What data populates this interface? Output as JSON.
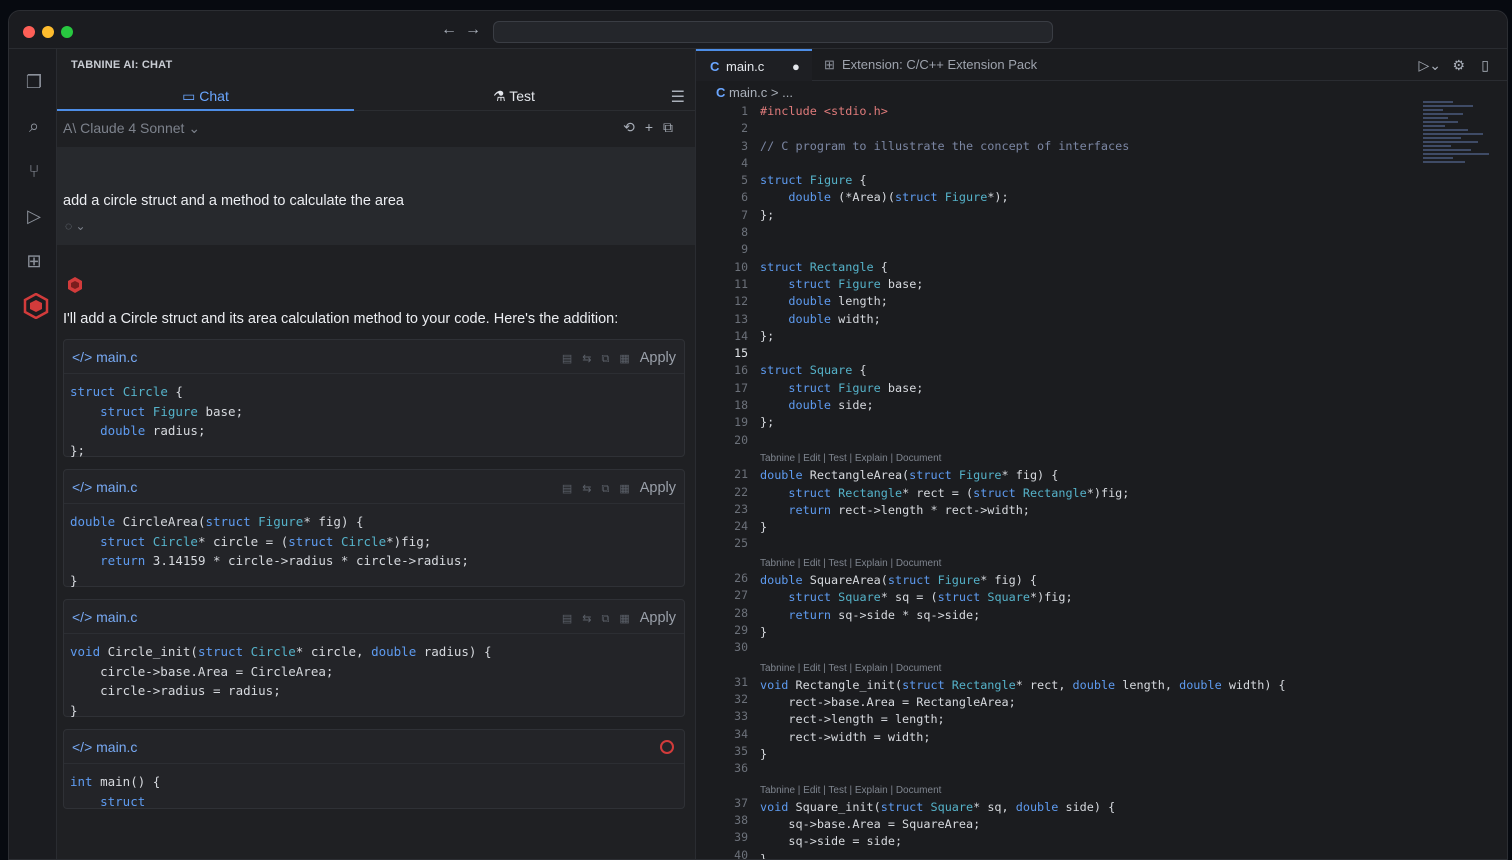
{
  "window": {
    "address_value": ""
  },
  "chat_panel": {
    "title": "TABNINE AI: CHAT",
    "tabs": [
      {
        "label": "Chat",
        "icon": "chat-bubble-icon"
      },
      {
        "label": "Test",
        "icon": "flask-icon"
      }
    ],
    "model": "Claude 4 Sonnet",
    "user_message": "add a circle struct and a method to calculate the area",
    "assistant_intro": "I'll add a Circle struct and its area calculation method to your code. Here's the addition:",
    "code_cards": [
      {
        "file": "main.c",
        "apply_label": "Apply"
      },
      {
        "file": "main.c",
        "apply_label": "Apply"
      },
      {
        "file": "main.c",
        "apply_label": "Apply"
      },
      {
        "file": "main.c",
        "apply_label": ""
      }
    ]
  },
  "editor": {
    "tabs": [
      {
        "label": "main.c",
        "modified": true
      },
      {
        "label": "Extension: C/C++ Extension Pack"
      }
    ],
    "breadcrumb": "main.c > ...",
    "codelens": "Tabnine | Edit | Test | Explain | Document",
    "line_numbers": [
      "1",
      "2",
      "3",
      "4",
      "5",
      "6",
      "7",
      "8",
      "9",
      "10",
      "11",
      "12",
      "13",
      "14",
      "15",
      "16",
      "17",
      "18",
      "19",
      "20",
      "",
      "21",
      "22",
      "23",
      "24",
      "25",
      "",
      "26",
      "27",
      "28",
      "29",
      "30",
      "",
      "31",
      "32",
      "33",
      "34",
      "35",
      "36",
      "",
      "37",
      "38",
      "39",
      "40"
    ]
  },
  "colors": {
    "accent": "#4d8de6",
    "tabnine_red": "#d23b3b",
    "background": "#1e1f22"
  }
}
